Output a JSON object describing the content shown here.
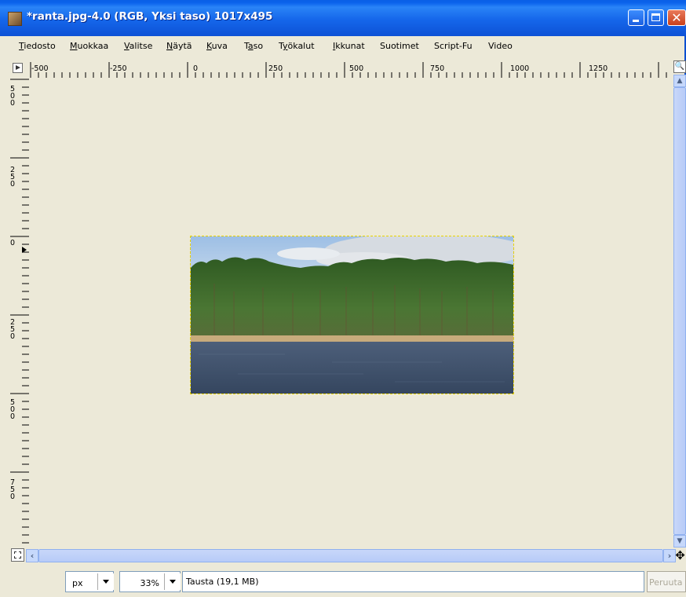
{
  "window": {
    "title": "*ranta.jpg-4.0 (RGB, Yksi taso) 1017x495",
    "minimize_icon": "minimize-icon",
    "maximize_icon": "maximize-icon",
    "close_icon": "close-icon",
    "close_glyph": "✕"
  },
  "menubar": {
    "items": [
      {
        "label": "Tiedosto",
        "mnemonic": "T",
        "rest": "iedosto"
      },
      {
        "label": "Muokkaa",
        "mnemonic": "M",
        "rest": "uokkaa"
      },
      {
        "label": "Valitse",
        "mnemonic": "V",
        "rest": "alitse"
      },
      {
        "label": "Näytä",
        "mnemonic": "N",
        "rest": "äytä"
      },
      {
        "label": "Kuva",
        "mnemonic": "K",
        "rest": "uva"
      },
      {
        "label": "Taso",
        "mnemonic_prefix": "T",
        "mnemonic": "a",
        "rest": "so"
      },
      {
        "label": "Työkalut",
        "mnemonic_prefix": "T",
        "mnemonic": "y",
        "rest": "ökalut"
      },
      {
        "label": "Ikkunat",
        "mnemonic": "I",
        "rest": "kkunat"
      },
      {
        "label": "Suotimet"
      },
      {
        "label": "Script-Fu"
      },
      {
        "label": "Video"
      }
    ]
  },
  "rulers": {
    "horizontal_labels": [
      "-500",
      "-250",
      "0",
      "250",
      "500",
      "750",
      "1000",
      "1250"
    ],
    "vertical_labels": [
      "500",
      "250",
      "0",
      "250",
      "500",
      "750"
    ]
  },
  "canvas": {
    "background": "#ece9d8",
    "image_alt": "Lakeside pine forest photo",
    "colors": {
      "sky": "#aecbea",
      "cloud": "#d8dde3",
      "forest": "#3f6a2c",
      "sand": "#c9ad7f",
      "water": "#3f5370"
    }
  },
  "statusbar": {
    "unit": "px",
    "zoom": "33%",
    "message": "Tausta (19,1 MB)",
    "cancel_label": "Peruuta"
  },
  "icons": {
    "quick_mask": "quick-mask-toggle-icon",
    "zoom": "zoom-icon",
    "navigate": "navigate-icon",
    "move": "move-icon",
    "move_glyph": "✥",
    "zoom_glyph": "🔍"
  }
}
